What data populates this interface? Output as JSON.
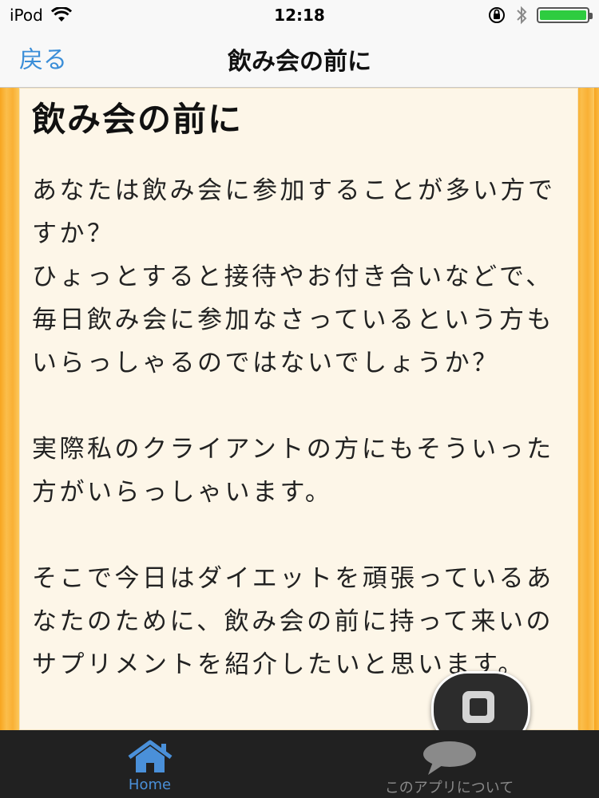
{
  "status_bar": {
    "carrier": "iPod",
    "time": "12:18",
    "battery_level": 1.0,
    "icons": [
      "wifi-icon",
      "orientation-lock-icon",
      "bluetooth-icon",
      "battery-icon"
    ]
  },
  "nav": {
    "back_label": "戻る",
    "title": "飲み会の前に"
  },
  "article": {
    "heading": "飲み会の前に",
    "paragraphs": [
      "あなたは飲み会に参加することが多い方ですか？\nひょっとすると接待やお付き合いなどで、毎日飲み会に参加なさっているという方もいらっしゃるのではないでしょうか？",
      "実際私のクライアントの方にもそういった方がいらっしゃいます。",
      "そこで今日はダイエットを頑張っているあなたのために、飲み会の前に持って来いのサプリメントを紹介したいと思います。"
    ]
  },
  "tabs": [
    {
      "label": "Home",
      "icon": "home-icon",
      "active": true
    },
    {
      "label": "このアプリについて",
      "icon": "speech-bubble-icon",
      "active": false
    }
  ],
  "colors": {
    "accent": "#3b8ed8",
    "tab_active": "#4a90d9",
    "tab_bar_bg": "#212121",
    "paper_bg": "#fdf6e8",
    "border_orange": "#f7a51f"
  }
}
